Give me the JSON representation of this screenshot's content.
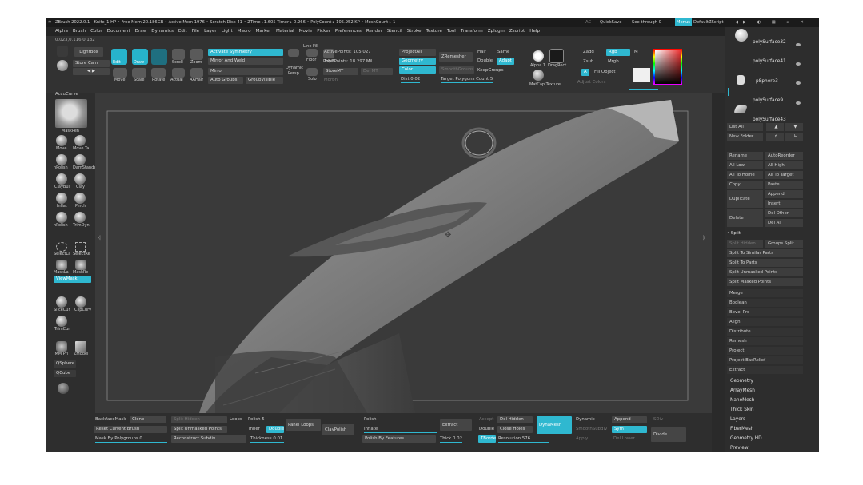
{
  "titlebar": {
    "text": "ZBrush 2022.0.1 - Knife_1 HP  • Free Mem 20.186GB • Active Mem 1976 • Scratch Disk 41 • ZTime ▸1.605 Timer ▸ 0.266 • PolyCount ▸ 105.952 KP • MeshCount ▸ 1",
    "ac": "AC",
    "quicksave": "QuickSave",
    "seethrough": "See-through  0",
    "menus": "Menus",
    "script": "DefaultZScript"
  },
  "menubar": [
    "Alpha",
    "Brush",
    "Color",
    "Document",
    "Draw",
    "Dynamics",
    "Edit",
    "File",
    "Layer",
    "Light",
    "Macro",
    "Marker",
    "Material",
    "Movie",
    "Picker",
    "Preferences",
    "Render",
    "Stencil",
    "Stroke",
    "Texture",
    "Tool",
    "Transform",
    "Zplugin",
    "Zscript",
    "Help"
  ],
  "coords": "0.023,0.116,0.132",
  "topshelf": {
    "lightbox": "LightBox",
    "store_cam": "Store Cam",
    "edit": "Edit",
    "draw": "Draw",
    "move": "Move",
    "scale": "Scale",
    "rotate": "Rotate",
    "scroll": "Scroll",
    "zoom": "Zoom",
    "actual": "Actual",
    "aahalf": "AAHalf",
    "activate_symmetry": "Activate Symmetry",
    "mirror_and_weld": "Mirror And Weld",
    "mirror": "Mirror",
    "autogroups": "Auto Groups",
    "groupvisible": "GroupVisible",
    "dynamic": "Dynamic",
    "persp": "Persp",
    "floor": "Floor",
    "solo": "Solo",
    "frame": "Frame",
    "polyf": "PolyF",
    "line_fill": "Line Fill",
    "active_points": "ActivePoints: 105,027",
    "total_points": "TotalPoints: 18.297 Mil",
    "store_mt": "StoreMT",
    "del_mt": "Del MT",
    "morph": "Morph",
    "project_all": "ProjectAll",
    "geometry": "Geometry",
    "color": "Color",
    "dist": "Dist 0.02",
    "zremesher": "ZRemesher",
    "smooth_groups": "SmoothGroups",
    "target_polygons": "Target Polygons Count 5",
    "half": "Half",
    "same": "Same",
    "double": "Double",
    "adapt": "Adapt",
    "keepgroups": "KeepGroups",
    "alpha_label": "Alpha 1",
    "draggrect": "DragRect",
    "matcap": "MatCap Texture",
    "adjust_colors": "Adjust Colors",
    "zadd": "Zadd",
    "zsub": "Zsub",
    "rgb": "Rgb",
    "mrgb": "Mrgb",
    "m": "M",
    "a": "A",
    "fill_object": "Fill Object"
  },
  "lefttray": {
    "accucurve": "AccuCurve",
    "maskpen": "MaskPen",
    "brushes": [
      [
        "Move",
        "Move Ta"
      ],
      [
        "hPolish",
        "DamStandard"
      ],
      [
        "ClayBuil",
        "Clay"
      ],
      [
        "Inflat",
        "Pinch"
      ],
      [
        "hPolish",
        "TrimDyn"
      ]
    ],
    "select_tools": [
      "SelectLa",
      "SelectRe"
    ],
    "mask_tools": [
      "MaskLa",
      "MaskRe"
    ],
    "viewmask": "ViewMask",
    "slice": [
      "SliceCur",
      "ClipCurv"
    ],
    "trimcur": "TrimCur",
    "imm": [
      "IMM Pri",
      "ZModel"
    ],
    "qsphere": "QSphere",
    "qcube": "QCube"
  },
  "rightpanel": {
    "subtools": [
      "polySurface32",
      "polySurface41",
      "pSphere3",
      "polySurface9",
      "polySurface43"
    ],
    "list_all": "List All",
    "new_folder": "New Folder",
    "rename": "Rename",
    "autoreorder": "AutoReorder",
    "all_low": "All Low",
    "all_high": "All High",
    "all_to_home": "All To Home",
    "all_to_target": "All To Target",
    "copy": "Copy",
    "paste": "Paste",
    "duplicate": "Duplicate",
    "append": "Append",
    "insert": "Insert",
    "delete": "Delete",
    "del_other": "Del Other",
    "del_all": "Del All",
    "split": "• Split",
    "split_hidden": "Split Hidden",
    "groups_split": "Groups Split",
    "split_to_similar": "Split To Similar Parts",
    "split_to_parts": "Split To Parts",
    "split_unmasked": "Split Unmasked Points",
    "split_masked": "Split Masked Points",
    "menu_items": [
      "Merge",
      "Boolean",
      "Bevel Pro",
      "Align",
      "Distribute",
      "Remesh",
      "Project",
      "Project BasRelief",
      "Extract"
    ],
    "bottom_items": [
      "Geometry",
      "ArrayMesh",
      "NanoMesh",
      "Thick Skin",
      "Layers",
      "FiberMesh",
      "Geometry HD",
      "Preview"
    ]
  },
  "bottomshelf": {
    "backface_mask": "BackfaceMask",
    "clone": "Clone",
    "split_hidden": "Split Hidden",
    "loops": "Loops",
    "polish": "Polish  5",
    "panel_loops": "Panel Loops",
    "claypolish": "ClayPolish",
    "polish2": "Polish",
    "extract": "Extract",
    "accept": "Accept",
    "del_hidden": "Del Hidden",
    "dynamesh": "DynaMesh",
    "dynamic": "Dynamic",
    "append": "Append",
    "reset_brush": "Reset Current Brush",
    "split_unmasked": "Split Unmasked Points",
    "inner": "Inner",
    "double": "Double",
    "inflate": "Inflate",
    "double2": "Double",
    "close_holes": "Close Holes",
    "smoothsubdiv": "SmoothSubdiv",
    "sym": "Sym",
    "divide": "Divide",
    "mask_polygroups": "Mask By Polygroups 0",
    "reconstruct": "Reconstruct Subdiv",
    "thickness": "Thickness 0.01",
    "polish_features": "Polish By Features",
    "thick": "Thick 0.02",
    "tborder": "TBorder",
    "resolution": "Resolution 576",
    "apply": "Apply",
    "del_lower": "Del Lower",
    "sdiv": "SDiv"
  }
}
